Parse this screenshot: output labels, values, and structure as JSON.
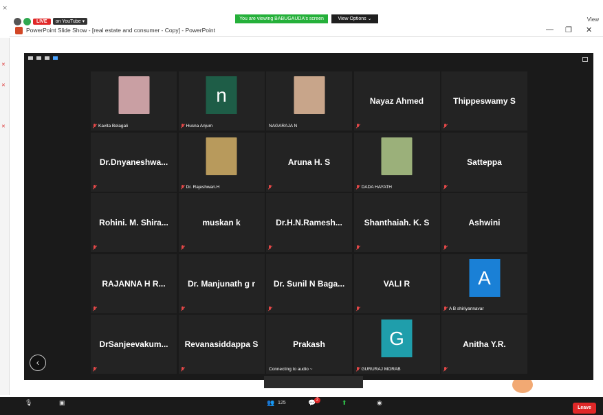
{
  "window": {
    "close_glyph": "×",
    "share_banner": "You are viewing BABUGAUDA's screen",
    "view_options": "View Options ⌄",
    "view_right": "View",
    "live_label": "LIVE",
    "youtube_label": "on YouTube ▾"
  },
  "ppt": {
    "title": "PowerPoint Slide Show - [real estate and consumer - Copy] - PowerPoint",
    "minimize": "—",
    "restore": "❐",
    "close": "✕"
  },
  "gallery": {
    "back_glyph": "‹",
    "tiles": [
      {
        "type": "photo",
        "label": "Kavita Belagali",
        "photo_color": "#c99fa3",
        "muted": true
      },
      {
        "type": "letter",
        "letter": "n",
        "letter_bg": "#1e5d47",
        "label": "Husna Anjum",
        "muted": true
      },
      {
        "type": "photo",
        "label": "NAGARAJA N",
        "photo_color": "#c8a58a",
        "muted": false
      },
      {
        "type": "name",
        "name": "Nayaz Ahmed",
        "muted": true
      },
      {
        "type": "name",
        "name": "Thippeswamy S",
        "muted": true
      },
      {
        "type": "name",
        "name": "Dr.Dnyaneshwa...",
        "muted": true
      },
      {
        "type": "photo",
        "label": "Dr. Rajeshwari.H",
        "photo_color": "#b89a5c",
        "muted": true
      },
      {
        "type": "name",
        "name": "Aruna H. S",
        "muted": true
      },
      {
        "type": "photo",
        "label": "DADA HAYATH",
        "photo_color": "#9bb07a",
        "muted": true
      },
      {
        "type": "name",
        "name": "Satteppa",
        "muted": true
      },
      {
        "type": "name",
        "name": "Rohini. M. Shira...",
        "muted": true
      },
      {
        "type": "name",
        "name": "muskan k",
        "muted": true
      },
      {
        "type": "name",
        "name": "Dr.H.N.Ramesh...",
        "muted": true
      },
      {
        "type": "name",
        "name": "Shanthaiah. K. S",
        "muted": true
      },
      {
        "type": "name",
        "name": "Ashwini",
        "muted": true
      },
      {
        "type": "name",
        "name": "RAJANNA H R...",
        "muted": true
      },
      {
        "type": "name",
        "name": "Dr. Manjunath g r",
        "muted": true
      },
      {
        "type": "name",
        "name": "Dr. Sunil N Baga...",
        "muted": true
      },
      {
        "type": "name",
        "name": "VALI R",
        "muted": true
      },
      {
        "type": "letter",
        "letter": "A",
        "letter_bg": "#1a80d6",
        "label": "A B shiriyannavar",
        "muted": true
      },
      {
        "type": "name",
        "name": "DrSanjeevakum...",
        "muted": true
      },
      {
        "type": "name",
        "name": "Revanasiddappa S",
        "muted": true
      },
      {
        "type": "name",
        "name": "Prakash",
        "sub": "Connecting to audio ~",
        "muted": false
      },
      {
        "type": "letter",
        "letter": "G",
        "letter_bg": "#1f9eab",
        "label": "GURURAJ MORAB",
        "muted": true
      },
      {
        "type": "name",
        "name": "Anitha Y.R.",
        "muted": true
      }
    ]
  },
  "controls": {
    "participants_count": "125",
    "chat_badge": "2",
    "leave": "Leave"
  }
}
